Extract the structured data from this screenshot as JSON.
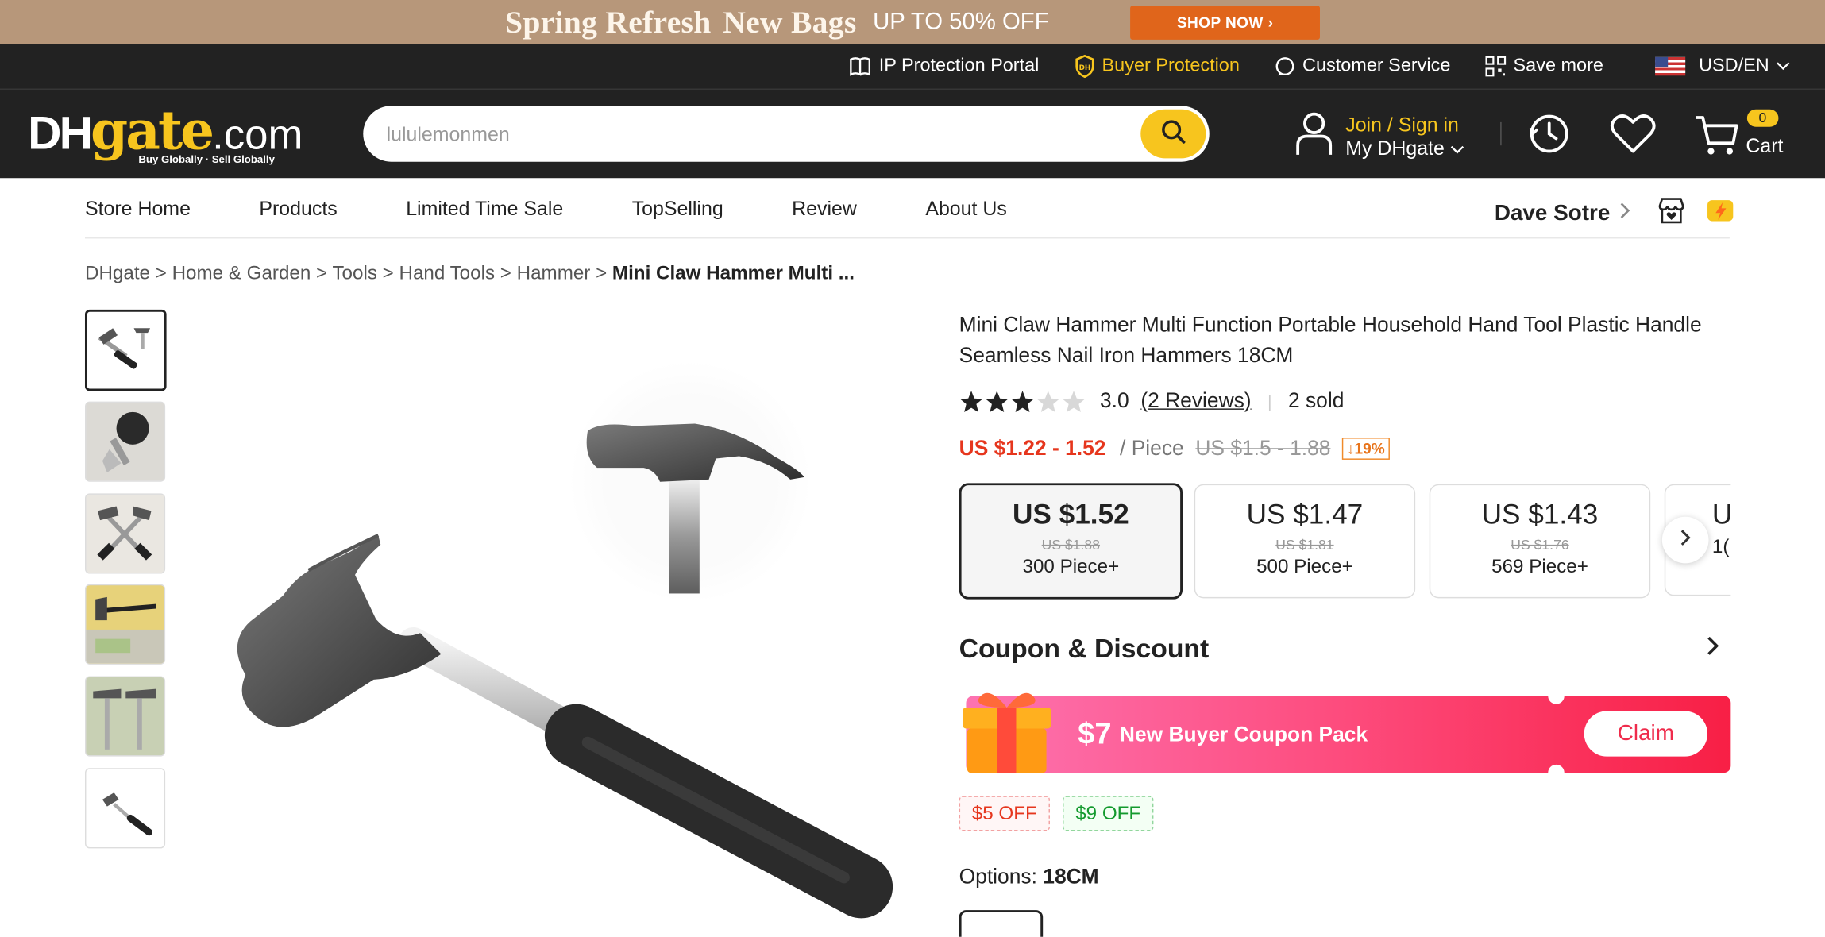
{
  "promo": {
    "line1": "Spring Refresh",
    "line2": "New Bags",
    "line3": "UP TO 50% OFF",
    "cta": "SHOP NOW ›"
  },
  "utility": {
    "ip": "IP Protection Portal",
    "buyer": "Buyer Protection",
    "service": "Customer Service",
    "save": "Save more",
    "currency": "USD/EN"
  },
  "header": {
    "logo_main": "DH",
    "logo_accent": "gate",
    "logo_suffix": ".com",
    "tagline": "Buy Globally · Sell Globally",
    "search_value": "lululemonmen",
    "join": "Join / Sign in",
    "my": "My DHgate",
    "cart_count": "0",
    "cart": "Cart"
  },
  "store_nav": {
    "links": [
      "Store Home",
      "Products",
      "Limited Time Sale",
      "TopSelling",
      "Review",
      "About Us"
    ],
    "store_name": "Dave Sotre"
  },
  "breadcrumb": {
    "items": [
      "DHgate",
      "Home & Garden",
      "Tools",
      "Hand Tools",
      "Hammer"
    ],
    "current": "Mini Claw Hammer Multi ..."
  },
  "product": {
    "title": "Mini Claw Hammer Multi Function Portable Household Hand Tool Plastic Handle Seamless Nail Iron Hammers 18CM",
    "rating_value": 3,
    "rating": "3.0",
    "reviews": "(2 Reviews)",
    "sold": "2 sold",
    "price": "US $1.22 - 1.52",
    "unit": "/ Piece",
    "old_price": "US $1.5 - 1.88",
    "discount": "↓19%",
    "tiers": [
      {
        "price": "US $1.52",
        "old": "US $1.88",
        "qty": "300 Piece+"
      },
      {
        "price": "US $1.47",
        "old": "US $1.81",
        "qty": "500 Piece+"
      },
      {
        "price": "US $1.43",
        "old": "US $1.76",
        "qty": "569 Piece+"
      },
      {
        "price": "U",
        "old": "",
        "qty": "1("
      }
    ]
  },
  "coupon": {
    "heading": "Coupon & Discount",
    "amount": "$7",
    "pack": "New Buyer Coupon Pack",
    "claim": "Claim",
    "chip1": "$5 OFF",
    "chip2": "$9 OFF"
  },
  "options": {
    "label": "Options:",
    "value": "18CM"
  },
  "colors": {
    "brand_yellow": "#f7c51e",
    "price_red": "#e6361d",
    "dark": "#222222"
  }
}
